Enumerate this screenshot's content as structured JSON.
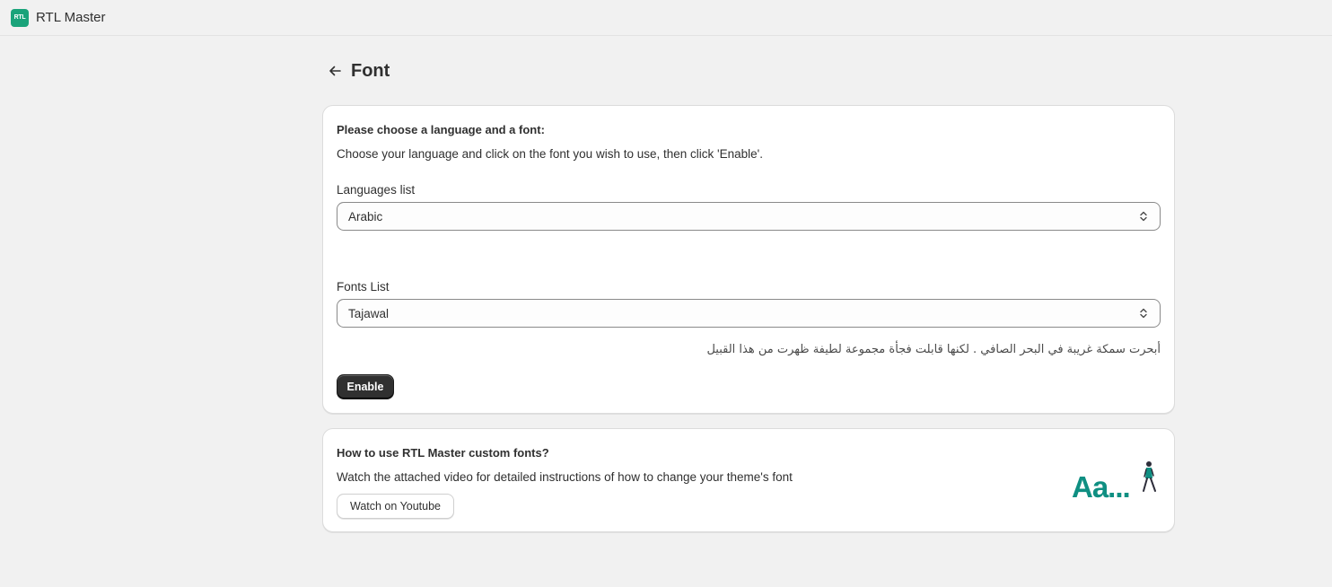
{
  "topbar": {
    "logo_text": "RTL",
    "app_name": "RTL Master"
  },
  "page": {
    "title": "Font",
    "back_icon": "arrow-left-icon"
  },
  "font_card": {
    "heading": "Please choose a language and a font:",
    "description": "Choose your language and click on the font you wish to use, then click 'Enable'.",
    "languages_label": "Languages list",
    "languages_value": "Arabic",
    "fonts_label": "Fonts List",
    "fonts_value": "Tajawal",
    "preview_text": "أبحرت سمكة غريبة في البحر الصافي . لكنها قابلت فجأة مجموعة لطيفة ظهرت من هذا القبيل",
    "enable_label": "Enable"
  },
  "help_card": {
    "heading": "How to use RTL Master custom fonts?",
    "description": "Watch the attached video for detailed instructions of how to change your theme's font",
    "youtube_label": "Watch on Youtube",
    "illustration_text": "Aa..."
  },
  "colors": {
    "accent": "#1aa37a",
    "illustration_teal": "#0f8f82",
    "primary_button": "#303030"
  }
}
